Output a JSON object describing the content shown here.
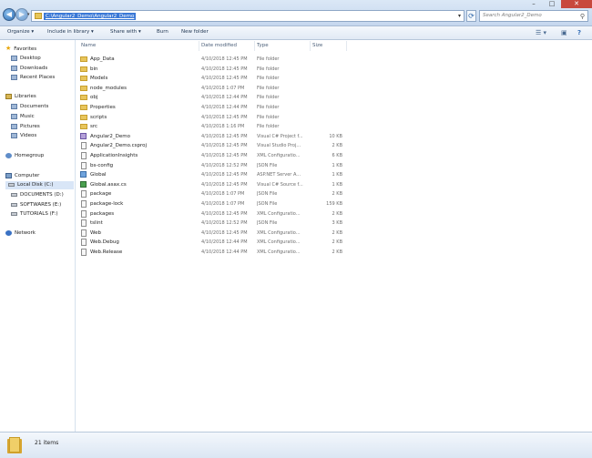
{
  "window": {
    "address_path": "C:\\Angular2_Demo\\Angular2_Demo",
    "search_placeholder": "Search Angular2_Demo",
    "min_glyph": "–",
    "max_glyph": "□",
    "close_glyph": "✕"
  },
  "nav": {
    "back_glyph": "◀",
    "forward_glyph": "▶",
    "dropdown_glyph": "▾",
    "refresh_glyph": "⟳"
  },
  "toolbar": {
    "organize": "Organize ▾",
    "include_in_library": "Include in library ▾",
    "share_with": "Share with ▾",
    "burn": "Burn",
    "new_folder": "New folder",
    "views_glyph": "☰ ▾",
    "preview_glyph": "▣",
    "help_glyph": "?"
  },
  "sidebar": {
    "favorites": "Favorites",
    "desktop": "Desktop",
    "downloads": "Downloads",
    "recent_places": "Recent Places",
    "libraries": "Libraries",
    "documents": "Documents",
    "music": "Music",
    "pictures": "Pictures",
    "videos": "Videos",
    "homegroup": "Homegroup",
    "computer": "Computer",
    "local_disk": "Local Disk (C:)",
    "documents_drive": "DOCUMENTS (D:)",
    "softwares_drive": "SOFTWARES (E:)",
    "tutorials_drive": "TUTORIALS (F:)",
    "network": "Network"
  },
  "columns": {
    "name": "Name",
    "date": "Date modified",
    "type": "Type",
    "size": "Size"
  },
  "files": [
    {
      "name": "App_Data",
      "date": "4/10/2018 12:45 PM",
      "type": "File folder",
      "size": "",
      "icon": "folder"
    },
    {
      "name": "bin",
      "date": "4/10/2018 12:45 PM",
      "type": "File folder",
      "size": "",
      "icon": "folder"
    },
    {
      "name": "Models",
      "date": "4/10/2018 12:45 PM",
      "type": "File folder",
      "size": "",
      "icon": "folder"
    },
    {
      "name": "node_modules",
      "date": "4/10/2018 1:07 PM",
      "type": "File folder",
      "size": "",
      "icon": "folder"
    },
    {
      "name": "obj",
      "date": "4/10/2018 12:44 PM",
      "type": "File folder",
      "size": "",
      "icon": "folder"
    },
    {
      "name": "Properties",
      "date": "4/10/2018 12:44 PM",
      "type": "File folder",
      "size": "",
      "icon": "folder"
    },
    {
      "name": "scripts",
      "date": "4/10/2018 12:45 PM",
      "type": "File folder",
      "size": "",
      "icon": "folder"
    },
    {
      "name": "src",
      "date": "4/10/2018 1:16 PM",
      "type": "File folder",
      "size": "",
      "icon": "folder"
    },
    {
      "name": "Angular2_Demo",
      "date": "4/10/2018 12:45 PM",
      "type": "Visual C# Project f...",
      "size": "10 KB",
      "icon": "proj"
    },
    {
      "name": "Angular2_Demo.csproj",
      "date": "4/10/2018 12:45 PM",
      "type": "Visual Studio Proj...",
      "size": "2 KB",
      "icon": "file"
    },
    {
      "name": "ApplicationInsights",
      "date": "4/10/2018 12:45 PM",
      "type": "XML Configuratio...",
      "size": "6 KB",
      "icon": "file"
    },
    {
      "name": "bs-config",
      "date": "4/10/2018 12:52 PM",
      "type": "JSON File",
      "size": "1 KB",
      "icon": "file"
    },
    {
      "name": "Global",
      "date": "4/10/2018 12:45 PM",
      "type": "ASP.NET Server A...",
      "size": "1 KB",
      "icon": "asax"
    },
    {
      "name": "Global.asax.cs",
      "date": "4/10/2018 12:45 PM",
      "type": "Visual C# Source f...",
      "size": "1 KB",
      "icon": "cs"
    },
    {
      "name": "package",
      "date": "4/10/2018 1:07 PM",
      "type": "JSON File",
      "size": "2 KB",
      "icon": "file"
    },
    {
      "name": "package-lock",
      "date": "4/10/2018 1:07 PM",
      "type": "JSON File",
      "size": "159 KB",
      "icon": "file"
    },
    {
      "name": "packages",
      "date": "4/10/2018 12:45 PM",
      "type": "XML Configuratio...",
      "size": "2 KB",
      "icon": "file"
    },
    {
      "name": "tslint",
      "date": "4/10/2018 12:52 PM",
      "type": "JSON File",
      "size": "3 KB",
      "icon": "file"
    },
    {
      "name": "Web",
      "date": "4/10/2018 12:45 PM",
      "type": "XML Configuratio...",
      "size": "2 KB",
      "icon": "file"
    },
    {
      "name": "Web.Debug",
      "date": "4/10/2018 12:44 PM",
      "type": "XML Configuratio...",
      "size": "2 KB",
      "icon": "file"
    },
    {
      "name": "Web.Release",
      "date": "4/10/2018 12:44 PM",
      "type": "XML Configuratio...",
      "size": "2 KB",
      "icon": "file"
    }
  ],
  "status": {
    "item_count": "21 items"
  }
}
